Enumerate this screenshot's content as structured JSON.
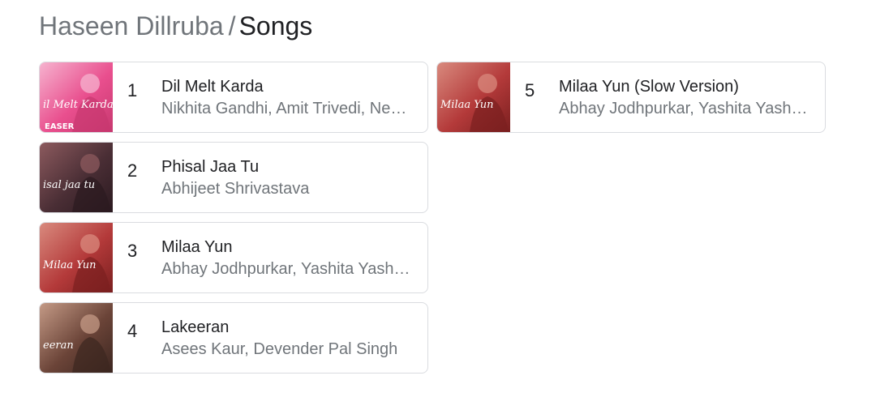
{
  "breadcrumb": {
    "parent": "Haseen Dillruba",
    "separator": "/",
    "current": "Songs"
  },
  "songs": [
    {
      "rank": "1",
      "title": "Dil Melt Karda",
      "artists": "Nikhita Gandhi, Amit Trivedi, Neha Kakkar",
      "thumb_text": "il Melt Karda",
      "thumb_badge": "EASER",
      "colors": [
        "#e94f8e",
        "#f6b3cf",
        "#c7386f"
      ]
    },
    {
      "rank": "2",
      "title": "Phisal Jaa Tu",
      "artists": "Abhijeet Shrivastava",
      "thumb_text": "isal jaa tu",
      "colors": [
        "#4a2e35",
        "#8c5a5e",
        "#2b1a20"
      ]
    },
    {
      "rank": "3",
      "title": "Milaa Yun",
      "artists": "Abhay Jodhpurkar, Yashita Yashpal Sharma",
      "thumb_text": "Milaa Yun",
      "colors": [
        "#b43a3a",
        "#d98a7e",
        "#7a1f1f"
      ]
    },
    {
      "rank": "4",
      "title": "Lakeeran",
      "artists": "Asees Kaur, Devender Pal Singh",
      "thumb_text": "eeran",
      "colors": [
        "#6b4438",
        "#c49a86",
        "#3c2620"
      ]
    },
    {
      "rank": "5",
      "title": "Milaa Yun (Slow Version)",
      "artists": "Abhay Jodhpurkar, Yashita Yashpal Sharma",
      "thumb_text": "Milaa Yun",
      "colors": [
        "#b43a3a",
        "#d98a7e",
        "#7a1f1f"
      ]
    }
  ]
}
